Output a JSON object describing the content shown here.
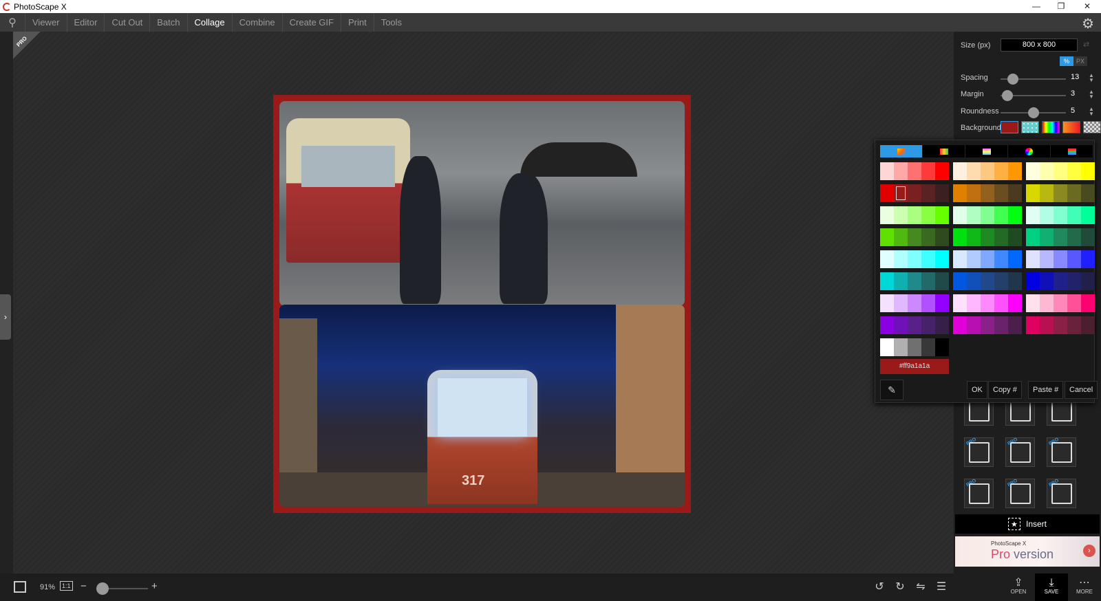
{
  "window": {
    "title": "PhotoScape X",
    "minimize": "—",
    "maximize": "❐",
    "close": "✕"
  },
  "menu": {
    "items": [
      "Viewer",
      "Editor",
      "Cut Out",
      "Batch",
      "Collage",
      "Combine",
      "Create GIF",
      "Print",
      "Tools"
    ],
    "active": "Collage"
  },
  "pro_ribbon": "PRO",
  "canvas": {
    "background_color": "#9a1a1a",
    "photo2_tram_number": "317"
  },
  "right_panel": {
    "size_label": "Size (px)",
    "size_value": "800 x 800",
    "unit_percent": "%",
    "unit_px": "PX",
    "spacing_label": "Spacing",
    "spacing_value": "13",
    "margin_label": "Margin",
    "margin_value": "3",
    "roundness_label": "Roundness",
    "roundness_value": "5",
    "background_label": "Background",
    "insert_label": "Insert",
    "banner_small": "PhotoScape X",
    "banner_pro": "Pro",
    "banner_version": " version"
  },
  "color_picker": {
    "hex_value": "#ff9a1a1a",
    "ok": "OK",
    "copy": "Copy #",
    "paste": "Paste #",
    "cancel": "Cancel",
    "palette": [
      [
        "#ffd6d6",
        "#ffa8a8",
        "#ff7070",
        "#ff3a3a",
        "#ff0000"
      ],
      [
        "#fff0e0",
        "#ffdcb0",
        "#ffc880",
        "#ffb040",
        "#ff9800"
      ],
      [
        "#ffffe0",
        "#ffffb0",
        "#ffff80",
        "#ffff40",
        "#ffff00"
      ],
      [
        "#e00000",
        "#9a1a1a",
        "#7a2020",
        "#5a2222",
        "#3a2020"
      ],
      [
        "#e08000",
        "#c07010",
        "#946020",
        "#6a4e22",
        "#4a3a20"
      ],
      [
        "#d8d800",
        "#b8b810",
        "#8a8a20",
        "#6a6a22",
        "#4a4a20"
      ],
      [
        "#eaffe0",
        "#ccffb0",
        "#aaff80",
        "#88ff40",
        "#66ff00"
      ],
      [
        "#e0ffe8",
        "#b0ffc0",
        "#80ff90",
        "#40ff50",
        "#00ff10"
      ],
      [
        "#e0fff4",
        "#b0ffe4",
        "#80ffd0",
        "#40ffb4",
        "#00ff98"
      ],
      [
        "#60e000",
        "#50b810",
        "#448a20",
        "#3a6a22",
        "#304a20"
      ],
      [
        "#00e010",
        "#10b818",
        "#208a22",
        "#226a26",
        "#204a22"
      ],
      [
        "#00d080",
        "#10b070",
        "#208a5c",
        "#226a4a",
        "#204a3a"
      ],
      [
        "#e0ffff",
        "#b0ffff",
        "#80ffff",
        "#40ffff",
        "#00ffff"
      ],
      [
        "#d8e8ff",
        "#b0ccff",
        "#80a8ff",
        "#4088ff",
        "#0068ff"
      ],
      [
        "#e0e0ff",
        "#b8b8ff",
        "#8888ff",
        "#5858ff",
        "#2020ff"
      ],
      [
        "#00d8d8",
        "#10b0b0",
        "#208a8a",
        "#226a6a",
        "#204a4a"
      ],
      [
        "#0058e0",
        "#1050b8",
        "#20488a",
        "#22406a",
        "#20364a"
      ],
      [
        "#0000e0",
        "#1010b8",
        "#20208a",
        "#22226a",
        "#20204a"
      ],
      [
        "#f4e0ff",
        "#e0b8ff",
        "#cc88ff",
        "#b050ff",
        "#9400ff"
      ],
      [
        "#ffe0ff",
        "#ffb8ff",
        "#ff88ff",
        "#ff50ff",
        "#ff00ff"
      ],
      [
        "#ffe0ec",
        "#ffb8d4",
        "#ff88b8",
        "#ff5098",
        "#ff0070"
      ],
      [
        "#8a00e0",
        "#7010b8",
        "#5a208a",
        "#46226a",
        "#36204a"
      ],
      [
        "#e000d8",
        "#b810b0",
        "#8a208a",
        "#6a226a",
        "#4a204a"
      ],
      [
        "#e00060",
        "#b81050",
        "#8a2046",
        "#6a223c",
        "#4a2030"
      ],
      [
        "#ffffff",
        "#b0b0b0",
        "#707070",
        "#383838",
        "#000000"
      ]
    ]
  },
  "bottom": {
    "zoom": "91%",
    "one_to_one": "1:1",
    "minus": "−",
    "plus": "+",
    "open": "OPEN",
    "save": "SAVE",
    "more": "MORE"
  }
}
